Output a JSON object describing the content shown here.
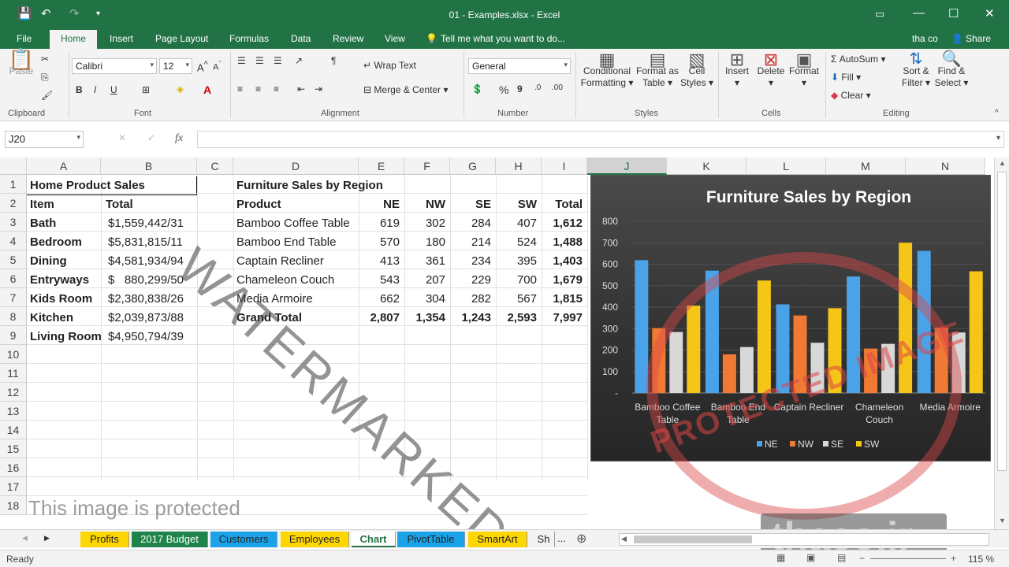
{
  "window": {
    "title": "01 - Examples.xlsx - Excel",
    "user": "tha co",
    "share_label": "Share"
  },
  "menu": {
    "tabs": [
      "File",
      "Home",
      "Insert",
      "Page Layout",
      "Formulas",
      "Data",
      "Review",
      "View"
    ],
    "active": "Home",
    "tell_me": "Tell me what you want to do..."
  },
  "ribbon": {
    "clipboard": {
      "paste": "Paste",
      "label": "Clipboard"
    },
    "font": {
      "name": "Calibri",
      "size": "12",
      "bold": "B",
      "italic": "I",
      "underline": "U",
      "label": "Font"
    },
    "alignment": {
      "wrap": "Wrap Text",
      "merge": "Merge & Center",
      "label": "Alignment"
    },
    "number": {
      "format": "General",
      "percent": "%",
      "comma": "9",
      "label": "Number"
    },
    "styles": {
      "conditional": [
        "Conditional",
        "Formatting"
      ],
      "format_table": [
        "Format as",
        "Table"
      ],
      "cell_styles": [
        "Cell",
        "Styles"
      ],
      "label": "Styles"
    },
    "cells": {
      "insert": "Insert",
      "delete": "Delete",
      "format": "Format",
      "label": "Cells"
    },
    "editing": {
      "autosum": "AutoSum",
      "fill": "Fill",
      "clear": "Clear",
      "sort": [
        "Sort &",
        "Filter"
      ],
      "find": [
        "Find &",
        "Select"
      ],
      "label": "Editing"
    }
  },
  "formula_bar": {
    "name_box": "J20",
    "fx": "fx",
    "value": ""
  },
  "columns": [
    "A",
    "B",
    "C",
    "D",
    "E",
    "F",
    "G",
    "H",
    "I",
    "J",
    "K",
    "L",
    "M",
    "N"
  ],
  "selected_column": "J",
  "rows": [
    "1",
    "2",
    "3",
    "4",
    "5",
    "6",
    "7",
    "8",
    "9",
    "10",
    "11",
    "12",
    "13",
    "14",
    "15",
    "16",
    "17",
    "18"
  ],
  "cells": {
    "A1": "Home Product Sales",
    "A2": "Item",
    "B2": "Total",
    "A3": "Bath",
    "B3": "$1,559,442/31",
    "A4": "Bedroom",
    "B4": "$5,831,815/11",
    "A5": "Dining",
    "B5": "$4,581,934/94",
    "A6": "Entryways",
    "B6": "$   880,299/50",
    "A7": "Kids Room",
    "B7": "$2,380,838/26",
    "A8": "Kitchen",
    "B8": "$2,039,873/88",
    "A9": "Living Room",
    "B9": "$4,950,794/39",
    "D1": "Furniture Sales by Region",
    "D2": "Product",
    "E2": "NE",
    "F2": "NW",
    "G2": "SE",
    "H2": "SW",
    "I2": "Total",
    "D3": "Bamboo Coffee Table",
    "E3": "619",
    "F3": "302",
    "G3": "284",
    "H3": "407",
    "I3": "1,612",
    "D4": "Bamboo End Table",
    "E4": "570",
    "F4": "180",
    "G4": "214",
    "H4": "524",
    "I4": "1,488",
    "D5": "Captain Recliner",
    "E5": "413",
    "F5": "361",
    "G5": "234",
    "H5": "395",
    "I5": "1,403",
    "D6": "Chameleon Couch",
    "E6": "543",
    "F6": "207",
    "G6": "229",
    "H6": "700",
    "I6": "1,679",
    "D7": "Media Armoire",
    "E7": "662",
    "F7": "304",
    "G7": "282",
    "H7": "567",
    "I7": "1,815",
    "D8": "Grand Total",
    "E8": "2,807",
    "F8": "1,354",
    "G8": "1,243",
    "H8": "2,593",
    "I8": "7,997"
  },
  "chart_data": {
    "type": "bar",
    "title": "Furniture Sales by Region",
    "categories": [
      "Bamboo Coffee Table",
      "Bamboo End Table",
      "Captain Recliner",
      "Chameleon Couch",
      "Media Armoire"
    ],
    "category_lines": [
      [
        "Bamboo Coffee",
        "Table"
      ],
      [
        "Bamboo End",
        "Table"
      ],
      [
        "Captain Recliner"
      ],
      [
        "Chameleon",
        "Couch"
      ],
      [
        "Media Armoire"
      ]
    ],
    "series": [
      {
        "name": "NE",
        "values": [
          619,
          570,
          413,
          543,
          662
        ]
      },
      {
        "name": "NW",
        "values": [
          302,
          180,
          361,
          207,
          304
        ]
      },
      {
        "name": "SE",
        "values": [
          284,
          214,
          234,
          229,
          282
        ]
      },
      {
        "name": "SW",
        "values": [
          407,
          524,
          395,
          700,
          567
        ]
      }
    ],
    "yticks": [
      "-",
      "100",
      "200",
      "300",
      "400",
      "500",
      "600",
      "700",
      "800"
    ],
    "ylim": [
      0,
      800
    ],
    "legend": "bottom",
    "colors": [
      "#4aa3e8",
      "#f07a34",
      "#d8d8d8",
      "#f5c518"
    ]
  },
  "sheet_tabs": [
    {
      "name": "Profits",
      "color": "#ffd700"
    },
    {
      "name": "2017 Budget",
      "color": "#1e8449"
    },
    {
      "name": "Customers",
      "color": "#1aa3e8"
    },
    {
      "name": "Employees",
      "color": "#ffd700"
    },
    {
      "name": "Chart",
      "color": "#ffffff"
    },
    {
      "name": "PivotTable",
      "color": "#1aa3e8"
    },
    {
      "name": "SmartArt",
      "color": "#ffd700"
    },
    {
      "name": "Sh",
      "color": "#f3f3f3"
    }
  ],
  "ellipsis": "...",
  "status": {
    "ready": "Ready",
    "zoom": "115 %"
  },
  "watermarks": {
    "diagonal": "WATERMARKED",
    "protected": "This image is protected",
    "stamp": "PROTECTED IMAGE",
    "site": "thaco.ir"
  }
}
